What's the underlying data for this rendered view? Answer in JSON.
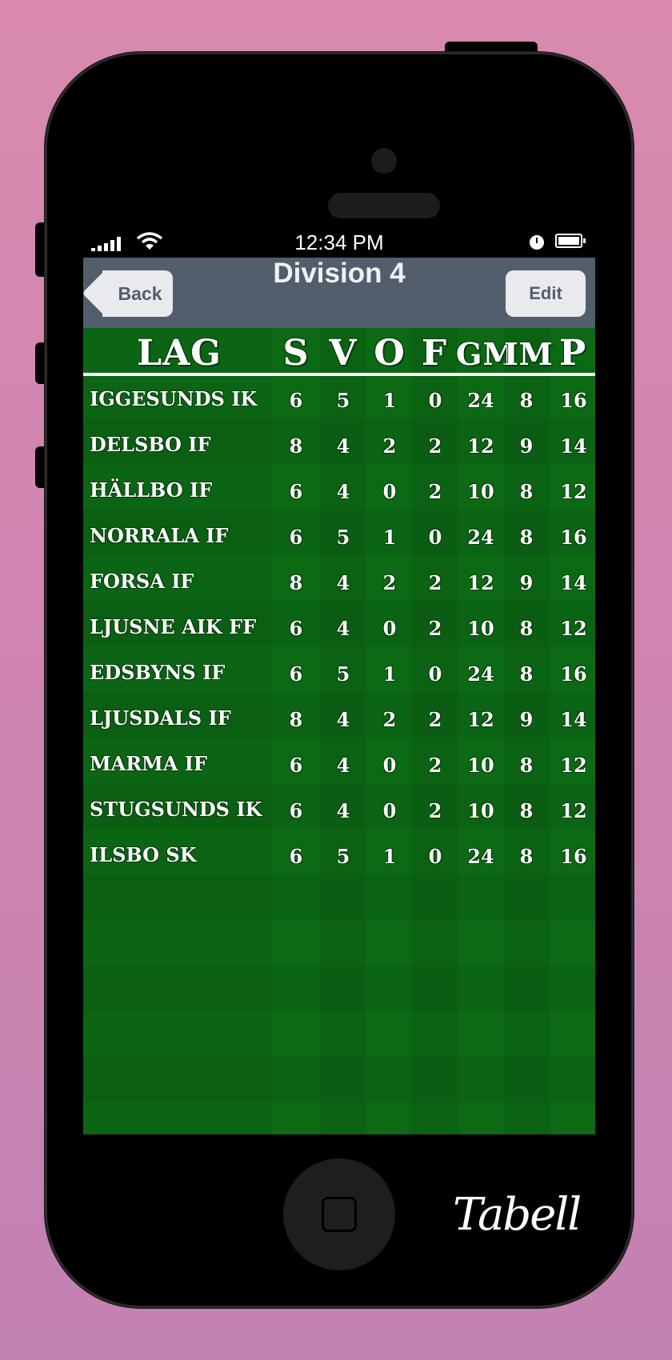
{
  "status_bar": {
    "time": "12:34 PM",
    "signal_icon": "signal-bars-icon",
    "wifi_icon": "wifi-icon",
    "alarm_icon": "clock-icon",
    "battery_icon": "battery-icon"
  },
  "navbar": {
    "back_label": "Back",
    "title": "Division 4",
    "edit_label": "Edit"
  },
  "table": {
    "headers": [
      "LAG",
      "S",
      "V",
      "O",
      "F",
      "GM",
      "IM",
      "P"
    ],
    "rows": [
      {
        "team": "IGGESUNDS IK",
        "s": "6",
        "v": "5",
        "o": "1",
        "f": "0",
        "gm": "24",
        "im": "8",
        "p": "16"
      },
      {
        "team": "DELSBO IF",
        "s": "8",
        "v": "4",
        "o": "2",
        "f": "2",
        "gm": "12",
        "im": "9",
        "p": "14"
      },
      {
        "team": "HÄLLBO IF",
        "s": "6",
        "v": "4",
        "o": "0",
        "f": "2",
        "gm": "10",
        "im": "8",
        "p": "12"
      },
      {
        "team": "NORRALA IF",
        "s": "6",
        "v": "5",
        "o": "1",
        "f": "0",
        "gm": "24",
        "im": "8",
        "p": "16"
      },
      {
        "team": "FORSA IF",
        "s": "8",
        "v": "4",
        "o": "2",
        "f": "2",
        "gm": "12",
        "im": "9",
        "p": "14"
      },
      {
        "team": "LJUSNE AIK FF",
        "s": "6",
        "v": "4",
        "o": "0",
        "f": "2",
        "gm": "10",
        "im": "8",
        "p": "12"
      },
      {
        "team": "EDSBYNS IF",
        "s": "6",
        "v": "5",
        "o": "1",
        "f": "0",
        "gm": "24",
        "im": "8",
        "p": "16"
      },
      {
        "team": "LJUSDALS IF",
        "s": "8",
        "v": "4",
        "o": "2",
        "f": "2",
        "gm": "12",
        "im": "9",
        "p": "14"
      },
      {
        "team": "MARMA IF",
        "s": "6",
        "v": "4",
        "o": "0",
        "f": "2",
        "gm": "10",
        "im": "8",
        "p": "12"
      },
      {
        "team": "STUGSUNDS IK",
        "s": "6",
        "v": "4",
        "o": "0",
        "f": "2",
        "gm": "10",
        "im": "8",
        "p": "12"
      },
      {
        "team": "ILSBO SK",
        "s": "6",
        "v": "5",
        "o": "1",
        "f": "0",
        "gm": "24",
        "im": "8",
        "p": "16"
      }
    ]
  },
  "device": {
    "home_button_icon": "home-button-icon",
    "brand": "Tabell"
  },
  "colors": {
    "background": "#d98aae",
    "navbar": "#535e6c",
    "field": "#0c6a15",
    "button": "#e8eaee"
  }
}
